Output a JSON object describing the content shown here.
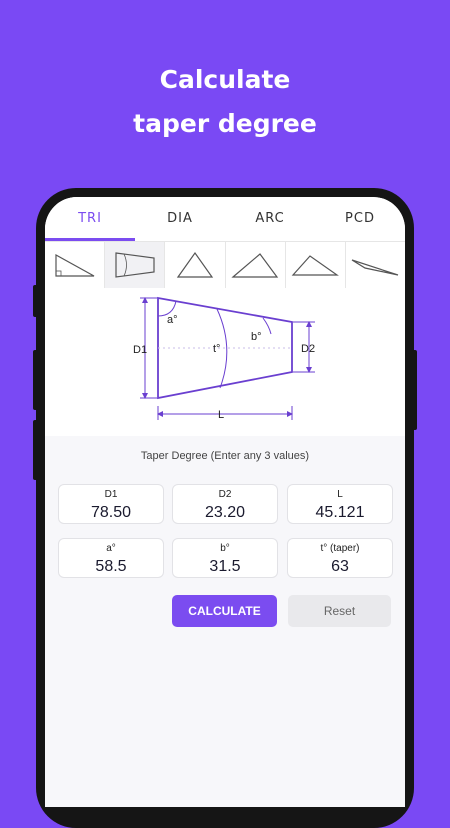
{
  "promo": {
    "line1": "Calculate",
    "line2": "taper degree"
  },
  "tabs": [
    {
      "label": "TRI",
      "active": true
    },
    {
      "label": "DIA",
      "active": false
    },
    {
      "label": "ARC",
      "active": false
    },
    {
      "label": "PCD",
      "active": false
    }
  ],
  "shape_icons": [
    "right-triangle-icon",
    "taper-icon",
    "equilateral-triangle-icon",
    "scalene-triangle-icon",
    "obtuse-triangle-icon",
    "obtuse-triangle-flat-icon"
  ],
  "diagram": {
    "a_label": "a°",
    "b_label": "b°",
    "t_label": "t°",
    "d1_label": "D1",
    "d2_label": "D2",
    "l_label": "L"
  },
  "form": {
    "subtitle": "Taper Degree (Enter any 3 values)",
    "fields": [
      {
        "label": "D1",
        "value": "78.50"
      },
      {
        "label": "D2",
        "value": "23.20"
      },
      {
        "label": "L",
        "value": "45.121"
      },
      {
        "label": "a°",
        "value": "58.5"
      },
      {
        "label": "b°",
        "value": "31.5"
      },
      {
        "label": "t° (taper)",
        "value": "63"
      }
    ],
    "calculate_label": "CALCULATE",
    "reset_label": "Reset"
  },
  "colors": {
    "brand": "#7a49f4",
    "accent": "#7b4cf0",
    "diagram": "#6a3fd0"
  }
}
